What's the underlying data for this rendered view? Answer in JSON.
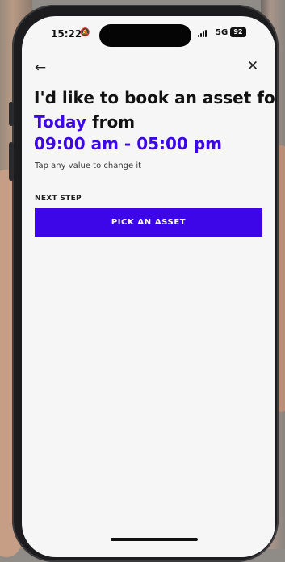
{
  "status_bar": {
    "time": "15:22",
    "network": "5G",
    "battery": "92",
    "icons": [
      "bell-off-icon",
      "signal-icon",
      "battery-icon"
    ]
  },
  "header": {
    "back_icon": "arrow-left-icon",
    "close_icon": "close-icon"
  },
  "booking": {
    "line1": "I'd like to book an asset for",
    "day": "Today",
    "from": "from",
    "time_range": "09:00 am - 05:00 pm",
    "hint": "Tap any value to change it"
  },
  "next_step": {
    "label": "NEXT STEP",
    "button_label": "PICK AN ASSET"
  },
  "colors": {
    "accent": "#3d06e8",
    "background": "#f6f6f7"
  }
}
